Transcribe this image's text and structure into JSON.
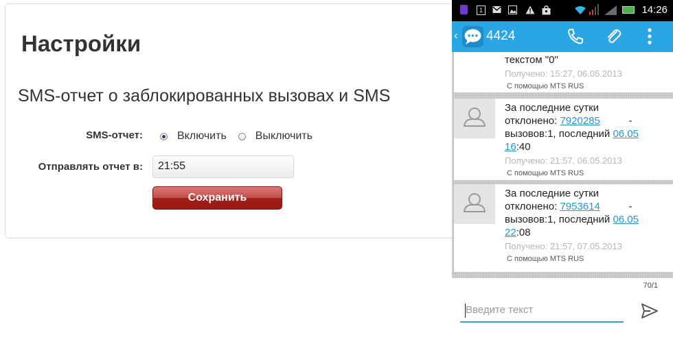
{
  "settings": {
    "title": "Настройки",
    "section_title": "SMS-отчет о заблокированных вызовах и SMS",
    "sms_report_label": "SMS-отчет:",
    "radio_on_label": "Включить",
    "radio_off_label": "Выключить",
    "selected": "on",
    "send_time_label": "Отправлять отчет в:",
    "send_time_value": "21:55",
    "save_label": "Сохранить"
  },
  "phone": {
    "status_bar": {
      "time": "14:26",
      "calendar_day": "1",
      "icons": [
        "notes-icon",
        "calendar-icon",
        "mail-icon",
        "image-icon",
        "warning-icon",
        "bag-icon",
        "wifi-icon",
        "signal-icon",
        "battery-icon"
      ]
    },
    "action_bar": {
      "back": "‹",
      "contact": "4424",
      "colors": {
        "bar": "#2ba6e4"
      }
    },
    "messages": [
      {
        "text": "текстом \"0\"",
        "received": "Получено: 15:27, 06.05.2013",
        "via": "С помощью  MTS RUS"
      },
      {
        "line1": "За последние сутки",
        "line2_prefix": "отклонено: ",
        "number": "7920285",
        "line2_suffix": "          -",
        "line3_prefix": "вызовов:1, последний ",
        "date_link": "06.05",
        "time_link": "16",
        "time_rest": ":40",
        "received": "Получено: 21:57, 06.05.2013",
        "via": "С помощью  MTS RUS"
      },
      {
        "line1": "За последние сутки",
        "line2_prefix": "отклонено: ",
        "number": "7953614",
        "line2_suffix": "          -",
        "line3_prefix": "вызовов:1, последний ",
        "date_link": "06.05",
        "time_link": "22",
        "time_rest": ":08",
        "received": "Получено: 21:57, 07.05.2013",
        "via": "С помощью  MTS RUS"
      }
    ],
    "counter": "70/1",
    "compose_placeholder": "Введите текст"
  }
}
